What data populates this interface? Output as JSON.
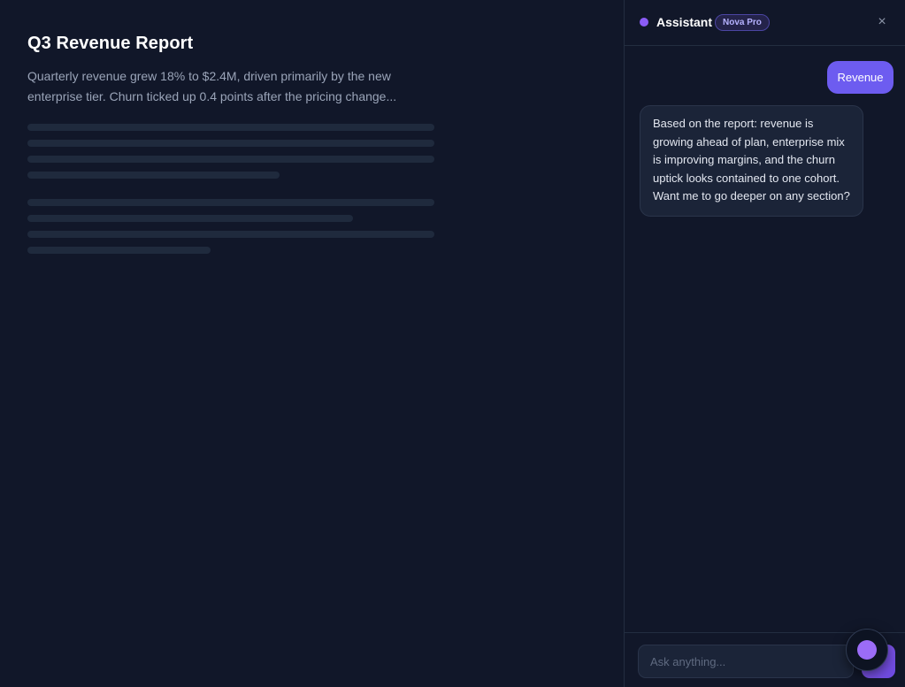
{
  "document": {
    "title": "Q3 Revenue Report",
    "summary": "Quarterly revenue grew 18% to $2.4M, driven primarily by the new enterprise tier. Churn ticked up 0.4 points after the pricing change..."
  },
  "assistant": {
    "title": "Assistant",
    "model_badge": "Nova Pro",
    "close_label": "×",
    "messages": [
      {
        "role": "user",
        "text": "Revenue"
      },
      {
        "role": "assistant",
        "text": "Based on the report: revenue is growing ahead of plan, enterprise mix is improving margins, and the churn uptick looks contained to one cohort. Want me to go deeper on any section?"
      }
    ],
    "composer": {
      "placeholder": "Ask anything..."
    }
  },
  "colors": {
    "background": "#111729",
    "accent": "#6d5cf0",
    "status_dot": "#8b5cf6"
  },
  "icons": {
    "status": "status-dot-icon",
    "close": "close-icon",
    "send": "send-icon",
    "launcher": "assistant-launcher-icon"
  }
}
